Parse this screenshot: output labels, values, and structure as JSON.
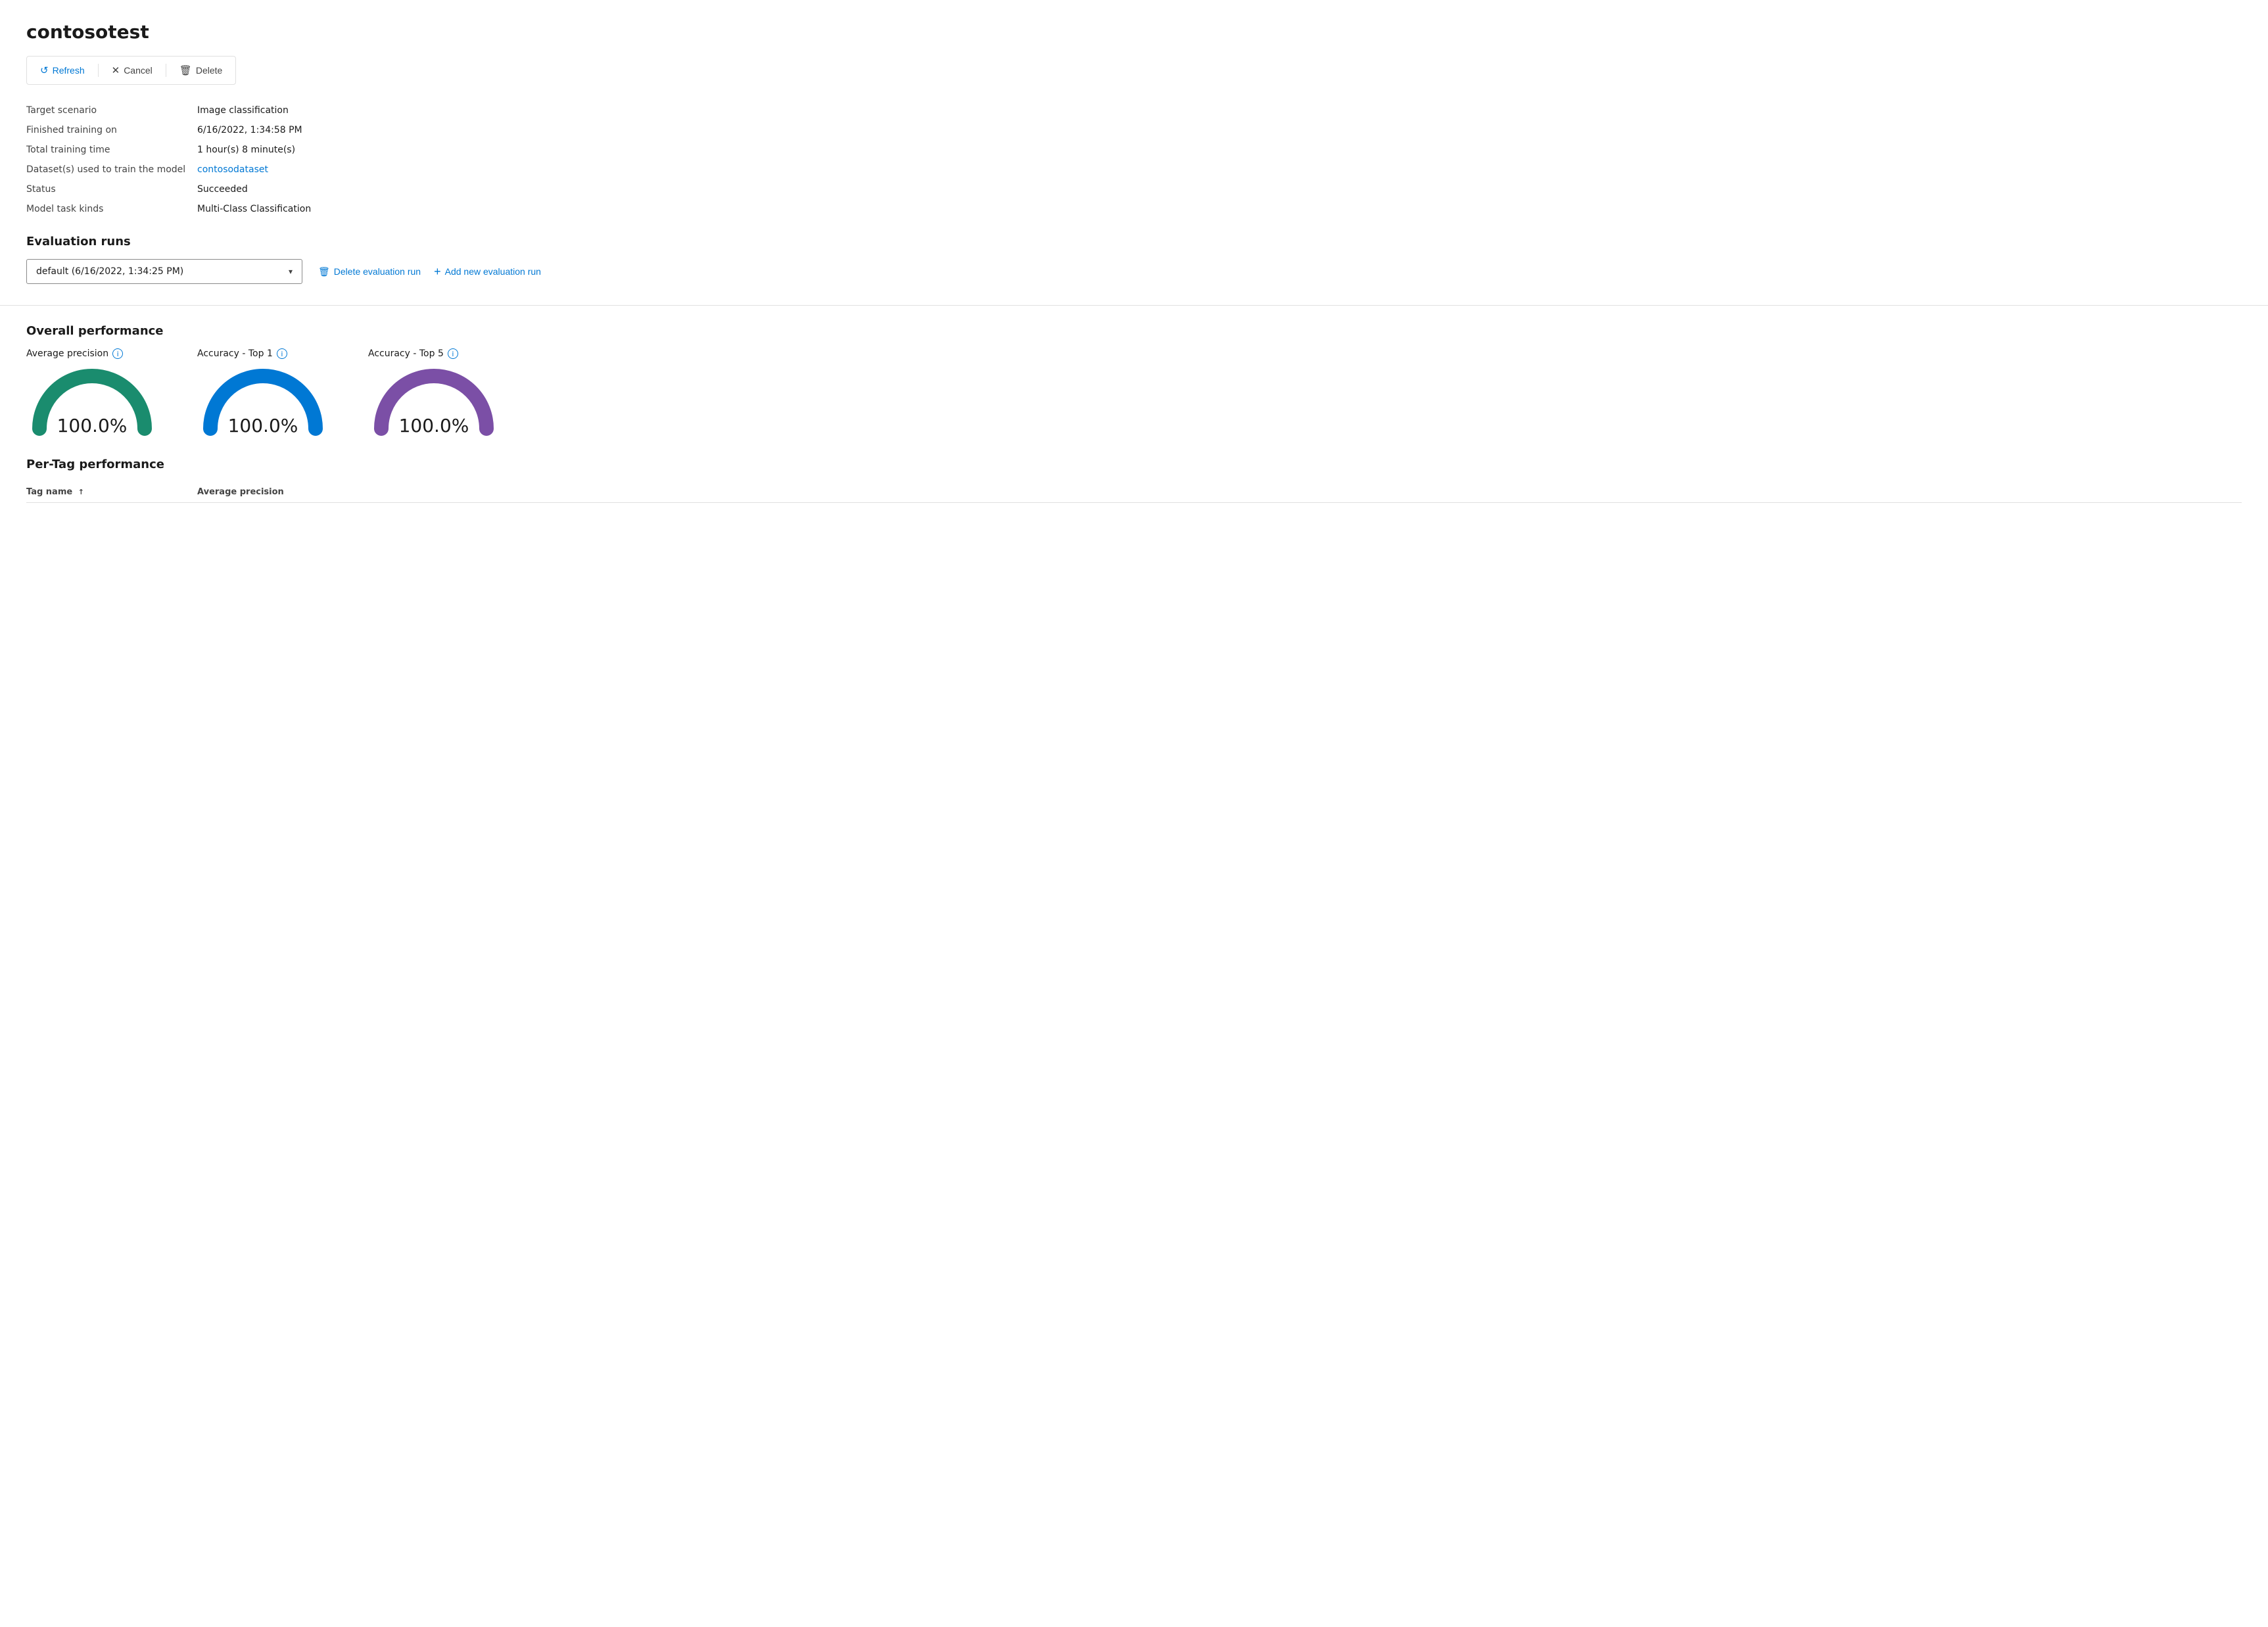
{
  "page": {
    "title": "contosotest"
  },
  "toolbar": {
    "refresh_label": "Refresh",
    "cancel_label": "Cancel",
    "delete_label": "Delete",
    "refresh_icon": "↺",
    "cancel_icon": "✕",
    "delete_icon": "🗑"
  },
  "info": {
    "target_scenario_label": "Target scenario",
    "target_scenario_value": "Image classification",
    "finished_training_label": "Finished training on",
    "finished_training_value": "6/16/2022, 1:34:58 PM",
    "total_training_label": "Total training time",
    "total_training_value": "1 hour(s) 8 minute(s)",
    "datasets_label": "Dataset(s) used to train the model",
    "datasets_value": "contosodataset",
    "status_label": "Status",
    "status_value": "Succeeded",
    "model_task_label": "Model task kinds",
    "model_task_value": "Multi-Class Classification"
  },
  "evaluation_runs": {
    "section_title": "Evaluation runs",
    "dropdown_value": "default (6/16/2022, 1:34:25 PM)",
    "delete_btn": "Delete evaluation run",
    "add_btn": "Add new evaluation run"
  },
  "overall_performance": {
    "section_title": "Overall performance",
    "gauges": [
      {
        "label": "Average precision",
        "value": "100.0%",
        "color": "#1a8c6e",
        "id": "gauge-avg-precision"
      },
      {
        "label": "Accuracy - Top 1",
        "value": "100.0%",
        "color": "#0078d4",
        "id": "gauge-acc-top1"
      },
      {
        "label": "Accuracy - Top 5",
        "value": "100.0%",
        "color": "#7b4fa6",
        "id": "gauge-acc-top5"
      }
    ]
  },
  "per_tag": {
    "section_title": "Per-Tag performance",
    "columns": [
      {
        "label": "Tag name",
        "sort": "↑"
      },
      {
        "label": "Average precision"
      }
    ]
  },
  "colors": {
    "accent": "#0078d4",
    "border": "#e0e0e0"
  }
}
